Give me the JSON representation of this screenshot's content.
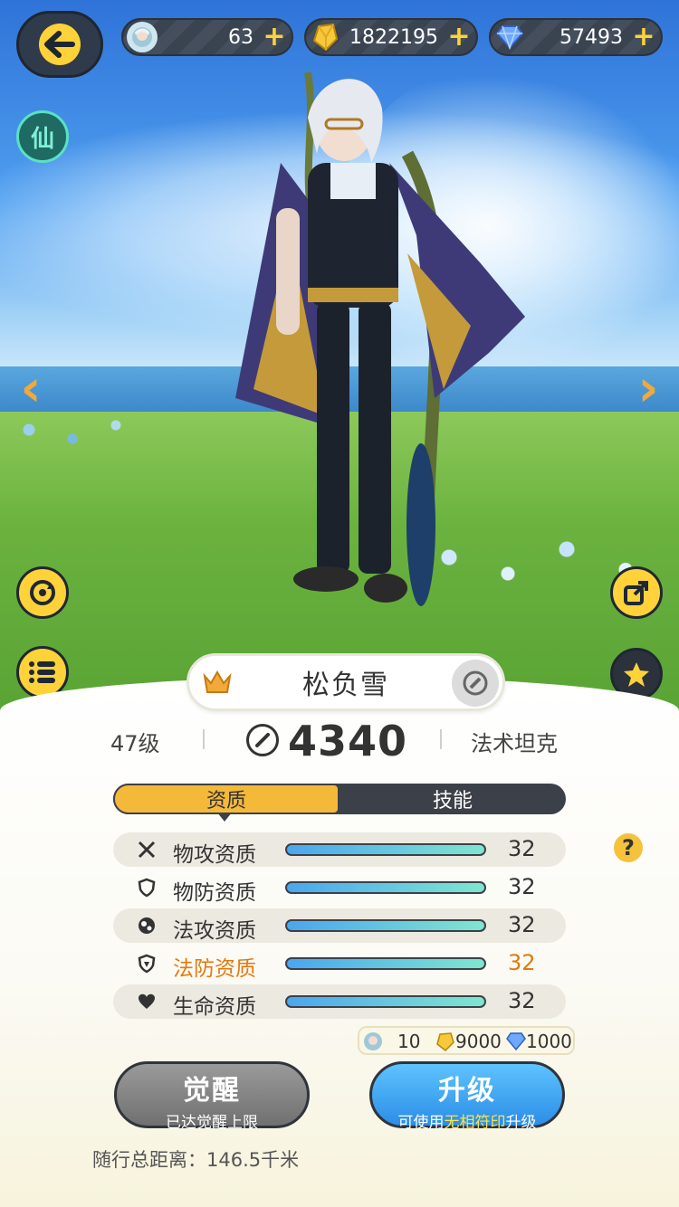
{
  "topbar": {
    "resources": [
      {
        "icon": "avatar-token-icon",
        "value": "63"
      },
      {
        "icon": "gold-crystal-icon",
        "value": "1822195"
      },
      {
        "icon": "diamond-icon",
        "value": "57493"
      }
    ],
    "plus_glyph": "+"
  },
  "side": {
    "xian_label": "仙"
  },
  "character": {
    "name": "松负雪",
    "level": "47级",
    "power": "4340",
    "role": "法术坦克"
  },
  "tabs": [
    {
      "label": "资质",
      "active": true
    },
    {
      "label": "技能",
      "active": false
    }
  ],
  "attributes": [
    {
      "label": "物攻资质",
      "value": "32",
      "icon": "swords-icon",
      "fill": 1.0,
      "highlight": false
    },
    {
      "label": "物防资质",
      "value": "32",
      "icon": "shield-icon",
      "fill": 1.0,
      "highlight": false
    },
    {
      "label": "法攻资质",
      "value": "32",
      "icon": "magic-orb-icon",
      "fill": 1.0,
      "highlight": false
    },
    {
      "label": "法防资质",
      "value": "32",
      "icon": "magic-shield-icon",
      "fill": 1.0,
      "highlight": true
    },
    {
      "label": "生命资质",
      "value": "32",
      "icon": "heart-icon",
      "fill": 1.0,
      "highlight": false
    }
  ],
  "help_glyph": "?",
  "cost": {
    "token": "10",
    "gold": "9000",
    "diamond": "1000"
  },
  "buttons": {
    "awaken": {
      "title": "觉醒",
      "subtitle": "已达觉醒上限"
    },
    "upgrade": {
      "title": "升级",
      "subtitle_prefix": "可使用",
      "subtitle_highlight": "无相符印",
      "subtitle_suffix": "升级"
    }
  },
  "distance": "随行总距离：146.5千米",
  "colors": {
    "accent_yellow": "#ffd23a",
    "tab_active": "#f5b93a",
    "highlight_orange": "#e07a10",
    "upgrade_blue": "#2b8de6"
  }
}
